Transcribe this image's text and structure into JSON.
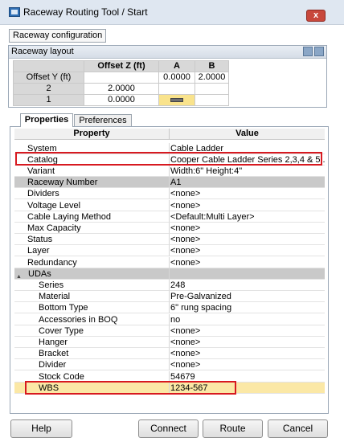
{
  "window": {
    "title": "Raceway Routing Tool / Start",
    "close_label": "x"
  },
  "raceway_config_label": "Raceway configuration",
  "layout": {
    "title": "Raceway layout",
    "header_buttons": [
      "collapse-icon",
      "pin-icon"
    ],
    "columns": [
      "Offset Z (ft)",
      "A",
      "B"
    ],
    "rows": [
      {
        "label": "Offset Y (ft)",
        "offset_z": "",
        "a": "0.0000",
        "b": "2.0000"
      },
      {
        "label": "2",
        "offset_z": "2.0000",
        "a": "",
        "b": ""
      },
      {
        "label": "1",
        "offset_z": "0.0000",
        "a": "",
        "b": ""
      }
    ],
    "selected_cell_icon": "cable-tray-icon"
  },
  "tabs": [
    {
      "label": "Properties",
      "active": true
    },
    {
      "label": "Preferences",
      "active": false
    }
  ],
  "props": {
    "headers": {
      "property": "Property",
      "value": "Value"
    },
    "rows": [
      {
        "name": "System",
        "value": "Cable Ladder"
      },
      {
        "name": "Catalog",
        "value": "Cooper Cable Ladder Series 2,3,4 & 5..."
      },
      {
        "name": "Variant",
        "value": "Width:6\" Height:4\""
      },
      {
        "name": "Raceway Number",
        "value": "A1"
      },
      {
        "name": "Dividers",
        "value": "<none>"
      },
      {
        "name": "Voltage Level",
        "value": "<none>"
      },
      {
        "name": "Cable Laying Method",
        "value": "<Default:Multi Layer>"
      },
      {
        "name": "Max Capacity",
        "value": "<none>"
      },
      {
        "name": "Status",
        "value": "<none>"
      },
      {
        "name": "Layer",
        "value": "<none>"
      },
      {
        "name": "Redundancy",
        "value": "<none>"
      },
      {
        "name": "UDAs",
        "value": "",
        "collapse_glyph": "▲"
      },
      {
        "name": "Series",
        "value": "248"
      },
      {
        "name": "Material",
        "value": "Pre-Galvanized"
      },
      {
        "name": "Bottom Type",
        "value": "6\" rung spacing"
      },
      {
        "name": "Accessories in BOQ",
        "value": "no"
      },
      {
        "name": "Cover Type",
        "value": "<none>"
      },
      {
        "name": "Hanger",
        "value": "<none>"
      },
      {
        "name": "Bracket",
        "value": "<none>"
      },
      {
        "name": "Divider",
        "value": "<none>"
      },
      {
        "name": "Stock Code",
        "value": "54679"
      },
      {
        "name": "WBS",
        "value": "1234-567"
      }
    ]
  },
  "buttons": {
    "help": "Help",
    "connect": "Connect",
    "route": "Route",
    "cancel": "Cancel"
  },
  "colors": {
    "highlight_box": "#d71920",
    "selected_row": "#fbe8a6",
    "shaded_row": "#c9c9c9"
  }
}
